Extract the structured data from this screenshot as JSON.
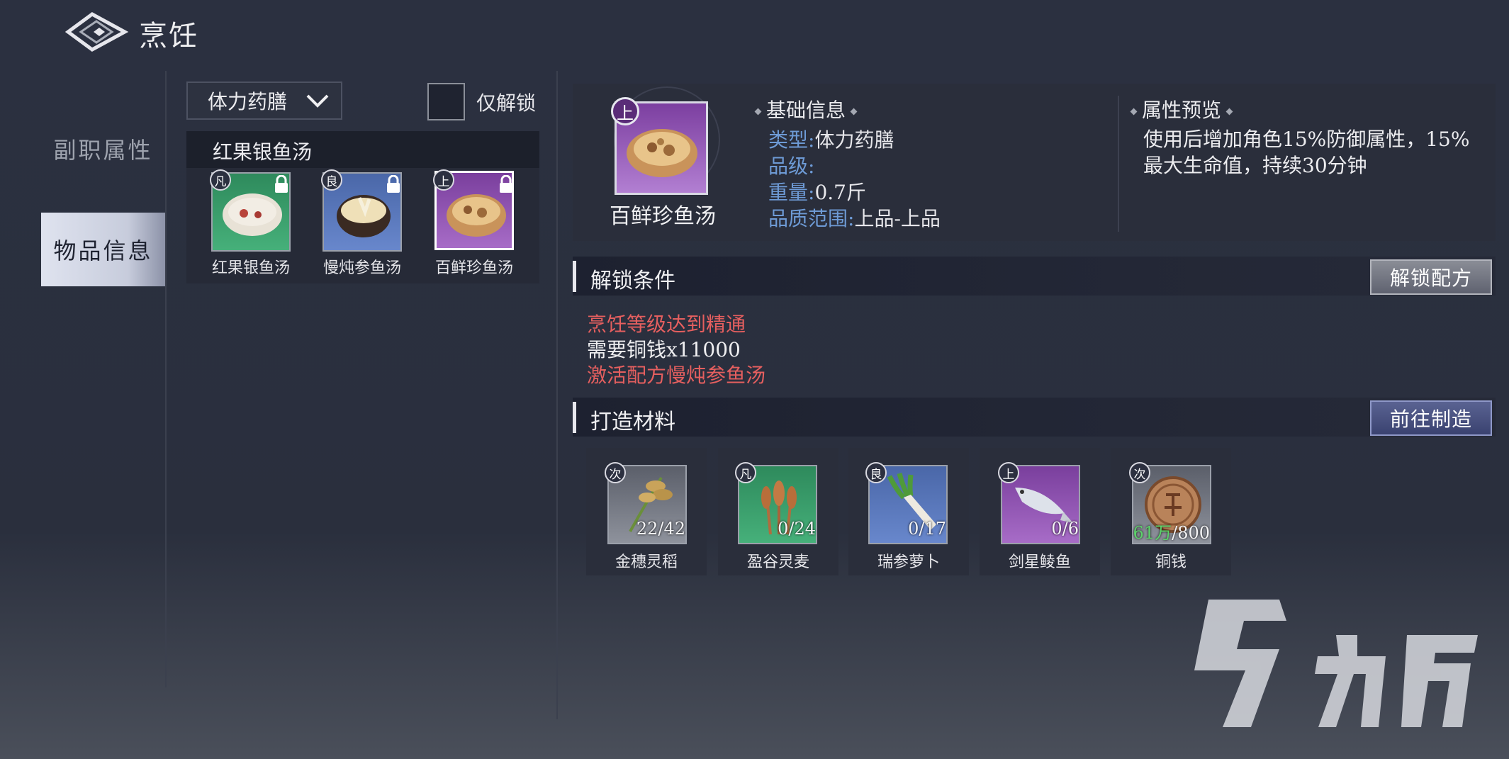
{
  "header": {
    "title": "烹饪",
    "back_icon": "diamond-back-icon"
  },
  "left_nav": {
    "items": [
      {
        "label": "副职属性",
        "active": false
      },
      {
        "label": "物品信息",
        "active": true
      }
    ]
  },
  "filter": {
    "category_selected": "体力药膳",
    "unlocked_only_label": "仅解锁"
  },
  "recipe_list": {
    "group_title": "红果银鱼汤",
    "items": [
      {
        "grade": "凡",
        "name": "红果银鱼汤",
        "rarity_color": "green",
        "locked": true
      },
      {
        "grade": "良",
        "name": "慢炖参鱼汤",
        "rarity_color": "blue",
        "locked": true
      },
      {
        "grade": "上",
        "name": "百鲜珍鱼汤",
        "rarity_color": "purple",
        "locked": true,
        "selected": true
      }
    ]
  },
  "item_detail": {
    "grade": "上",
    "name": "百鲜珍鱼汤",
    "basic_info_title": "基础信息",
    "fields": [
      {
        "key": "类型",
        "value": "体力药膳"
      },
      {
        "key": "品级",
        "value": ""
      },
      {
        "key": "重量",
        "value": "0.7斤"
      },
      {
        "key": "品质范围",
        "value": "上品-上品"
      }
    ],
    "attr_title": "属性预览",
    "attr_desc": "使用后增加角色15%防御属性，15%最大生命值，持续30分钟"
  },
  "unlock": {
    "title": "解锁条件",
    "button": "解锁配方",
    "conditions": [
      {
        "text": "烹饪等级达到精通",
        "met": false
      },
      {
        "text": "需要铜钱x11000",
        "met": true
      },
      {
        "text": "激活配方慢炖参鱼汤",
        "met": false
      }
    ]
  },
  "materials": {
    "title": "打造材料",
    "button": "前往制造",
    "items": [
      {
        "grade": "次",
        "name": "金穗灵稻",
        "have": "22",
        "need": "42",
        "rarity_color": "gray"
      },
      {
        "grade": "凡",
        "name": "盈谷灵麦",
        "have": "0",
        "need": "24",
        "rarity_color": "green"
      },
      {
        "grade": "良",
        "name": "瑞参萝卜",
        "have": "0",
        "need": "17",
        "rarity_color": "blue"
      },
      {
        "grade": "上",
        "name": "剑星鲮鱼",
        "have": "0",
        "need": "6",
        "rarity_color": "purple"
      },
      {
        "grade": "次",
        "name": "铜钱",
        "have": "61万",
        "need": "800",
        "rarity_color": "gray"
      }
    ]
  },
  "colors": {
    "condition_unmet": "#e55f5f",
    "field_key": "#6e9bd6",
    "active_nav": "#dfe3ef"
  }
}
